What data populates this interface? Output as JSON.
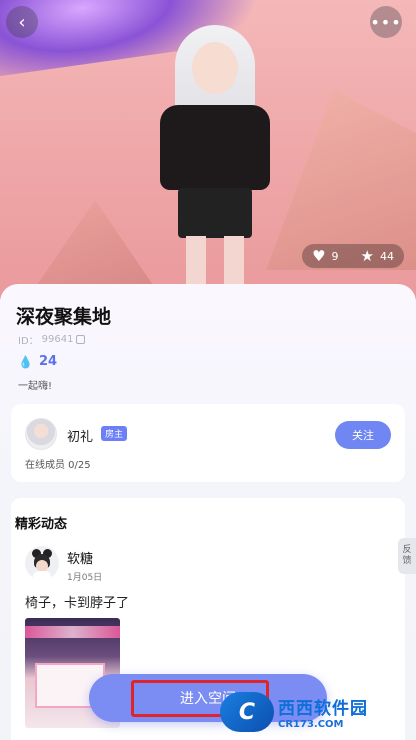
{
  "hero": {
    "likes": "9",
    "stars": "44"
  },
  "room": {
    "title": "深夜聚集地",
    "id_label": "ID：",
    "id_value": "99641",
    "heat": "24",
    "greeting": "一起嗨!"
  },
  "owner": {
    "name": "初礼",
    "badge": "房主",
    "follow_label": "关注",
    "members_label": "在线成员 0/25"
  },
  "feed": {
    "title": "精彩动态",
    "post": {
      "author": "软糖",
      "date": "1月05日",
      "text": "椅子，卡到脖子了"
    }
  },
  "actions": {
    "enter_label": "进入空间"
  },
  "feedback": {
    "label_1": "反",
    "label_2": "馈"
  },
  "watermark": {
    "logo": "C",
    "main": "西西软件园",
    "sub": "CR173.COM"
  },
  "colors": {
    "accent": "#6f86f3",
    "heat": "#5b72e9",
    "highlight": "#e0242d"
  }
}
